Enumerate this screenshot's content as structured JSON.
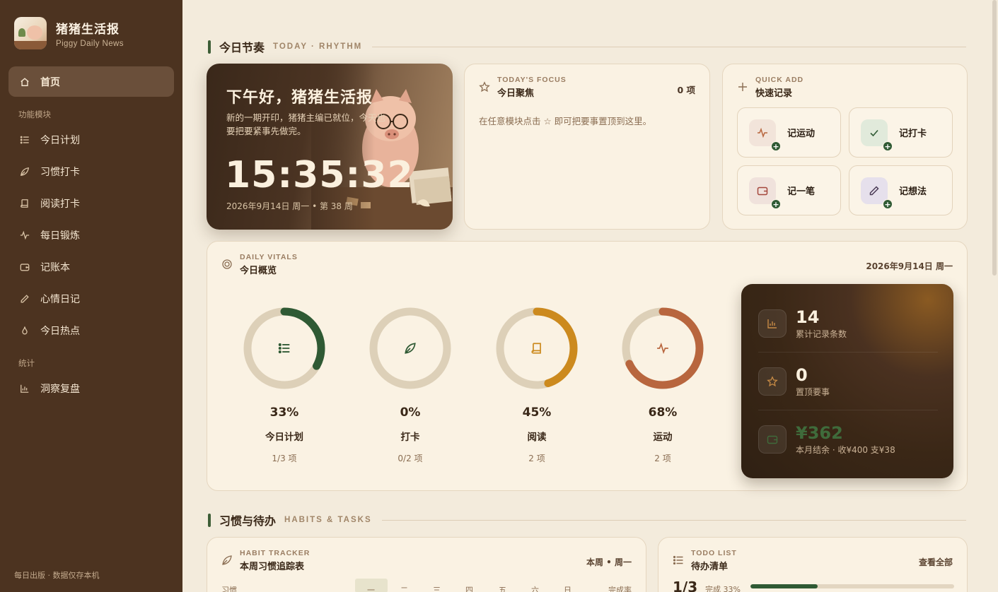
{
  "brand": {
    "title": "猪猪生活报",
    "subtitle": "Piggy Daily News"
  },
  "nav": {
    "home": "首页",
    "section_modules": "功能模块",
    "items": [
      {
        "label": "今日计划",
        "icon": "list-icon"
      },
      {
        "label": "习惯打卡",
        "icon": "leaf-icon"
      },
      {
        "label": "阅读打卡",
        "icon": "book-icon"
      },
      {
        "label": "每日锻炼",
        "icon": "pulse-icon"
      },
      {
        "label": "记账本",
        "icon": "wallet-icon"
      },
      {
        "label": "心情日记",
        "icon": "pencil-icon"
      },
      {
        "label": "今日热点",
        "icon": "flame-icon"
      }
    ],
    "section_stats": "统计",
    "stats_item": "洞察复盘",
    "footer": "每日出版 · 数据仅存本机"
  },
  "section_today": {
    "title": "今日节奏",
    "en": "TODAY · RHYTHM"
  },
  "hero": {
    "greeting": "下午好，猪猪生活报",
    "desc": "新的一期开印，猪猪主编已就位，今天也要把要紧事先做完。",
    "clock": "15:35:32",
    "date": "2026年9月14日 周一 • 第 38 周"
  },
  "focus": {
    "kicker": "TODAY'S FOCUS",
    "title": "今日聚焦",
    "count": "0 项",
    "hint": "在任意模块点击 ☆ 即可把要事置顶到这里。"
  },
  "quick": {
    "kicker": "QUICK ADD",
    "title": "快速记录",
    "buttons": [
      {
        "label": "记运动",
        "icon": "pulse-icon"
      },
      {
        "label": "记打卡",
        "icon": "check-icon"
      },
      {
        "label": "记一笔",
        "icon": "wallet-icon"
      },
      {
        "label": "记想法",
        "icon": "pencil-icon"
      }
    ]
  },
  "vitals": {
    "kicker": "DAILY VITALS",
    "title": "今日概览",
    "date": "2026年9月14日 周一",
    "rings": [
      {
        "pct": "33%",
        "fraction": 0.33,
        "label": "今日计划",
        "sub": "1/3 项",
        "color": "#2f5a34",
        "icon": "list-icon"
      },
      {
        "pct": "0%",
        "fraction": 0.0,
        "label": "打卡",
        "sub": "0/2 项",
        "color": "#2f5a34",
        "icon": "leaf-icon"
      },
      {
        "pct": "45%",
        "fraction": 0.45,
        "label": "阅读",
        "sub": "2 项",
        "color": "#cc8a1e",
        "icon": "book-icon"
      },
      {
        "pct": "68%",
        "fraction": 0.68,
        "label": "运动",
        "sub": "2 项",
        "color": "#b8663e",
        "icon": "pulse-icon"
      }
    ]
  },
  "stats": [
    {
      "value": "14",
      "label": "累计记录条数",
      "icon": "bar-chart-icon"
    },
    {
      "value": "0",
      "label": "置顶要事",
      "icon": "star-icon"
    },
    {
      "value": "¥362",
      "label": "本月结余 · 收¥400 支¥38",
      "icon": "wallet-icon"
    }
  ],
  "section_habits": {
    "title": "习惯与待办",
    "en": "HABITS & TASKS"
  },
  "habit": {
    "kicker": "HABIT TRACKER",
    "title": "本周习惯追踪表",
    "range": "本周 • 周一",
    "col_habit": "习惯",
    "days": [
      "一",
      "二",
      "三",
      "四",
      "五",
      "六",
      "日"
    ],
    "col_rate": "完成率"
  },
  "todo": {
    "kicker": "TODO LIST",
    "title": "待办清单",
    "more": "查看全部",
    "count": "1/3",
    "done": "完成 33%",
    "progress": 0.33
  },
  "colors": {
    "accent_green": "#2f5a34",
    "sidebar": "#4c3320",
    "paper": "#f3ebdc"
  }
}
